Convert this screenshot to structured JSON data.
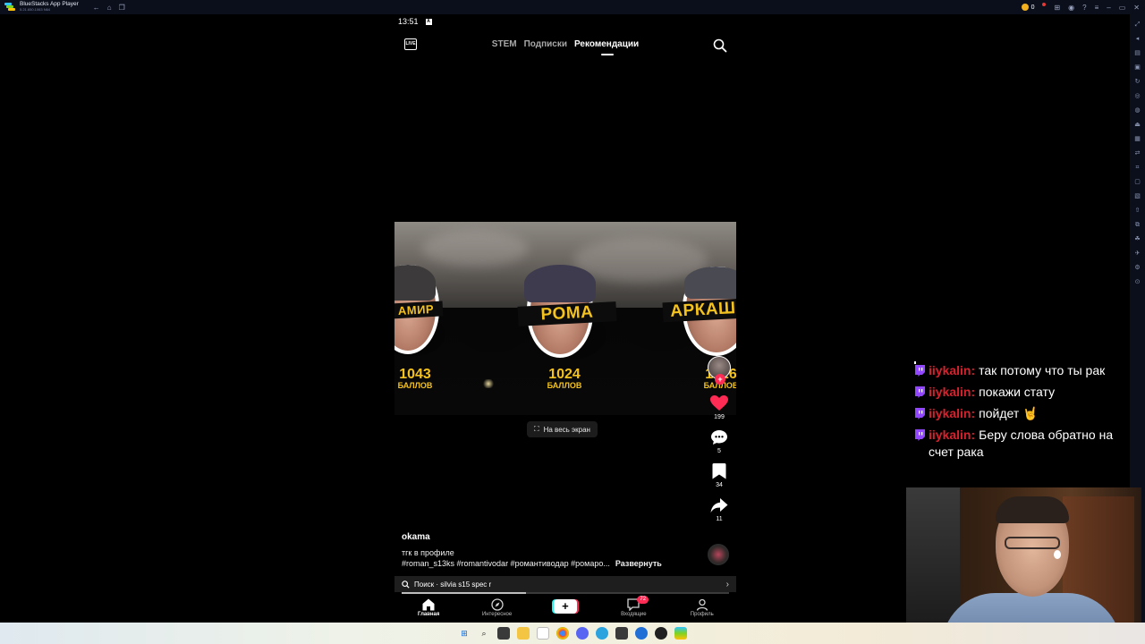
{
  "window": {
    "title": "BlueStacks App Player",
    "subtitle": "5.21.650.1063 N64",
    "coins": "0"
  },
  "phone": {
    "time": "13:51",
    "live_label": "LIVE",
    "tabs": [
      {
        "label": "STEM"
      },
      {
        "label": "Подписки"
      },
      {
        "label": "Рекомендации"
      }
    ],
    "video": {
      "left": {
        "name": "АМИР",
        "score": "1043",
        "unit": "БАЛЛОВ"
      },
      "center": {
        "name": "РОМА",
        "score": "1024",
        "unit": "БАЛЛОВ"
      },
      "right": {
        "name": "АРКАШ",
        "score": "1026",
        "unit": "БАЛЛОВ"
      }
    },
    "fullscreen_label": "На весь экран",
    "actions": {
      "likes": "199",
      "comments": "5",
      "saves": "34",
      "shares": "11"
    },
    "author": "okama",
    "description": "тгк в профиле",
    "hashtags": "#roman_s13ks #romantivodar #романтиводар #ромаро...",
    "expand_label": "Развернуть",
    "search_label": "Поиск · silvia s15 spec r",
    "progress": 0.38,
    "bottom_nav": [
      {
        "label": "Главная"
      },
      {
        "label": "Интересное"
      },
      {
        "label": ""
      },
      {
        "label": "Входящие",
        "badge": "72"
      },
      {
        "label": "Профиль"
      }
    ]
  },
  "chat": [
    {
      "user": "iiykalin:",
      "text": "так потому что ты рак"
    },
    {
      "user": "iiykalin:",
      "text": "покажи стату"
    },
    {
      "user": "iiykalin:",
      "text": "пойдет 🤘"
    },
    {
      "user": "iiykalin:",
      "text": "Беру слова обратно на счет рака"
    }
  ],
  "colors": {
    "accent_red": "#fe2c55",
    "chat_user": "#d6222f",
    "score_yellow": "#f4c21e",
    "twitch_purple": "#9146ff"
  }
}
